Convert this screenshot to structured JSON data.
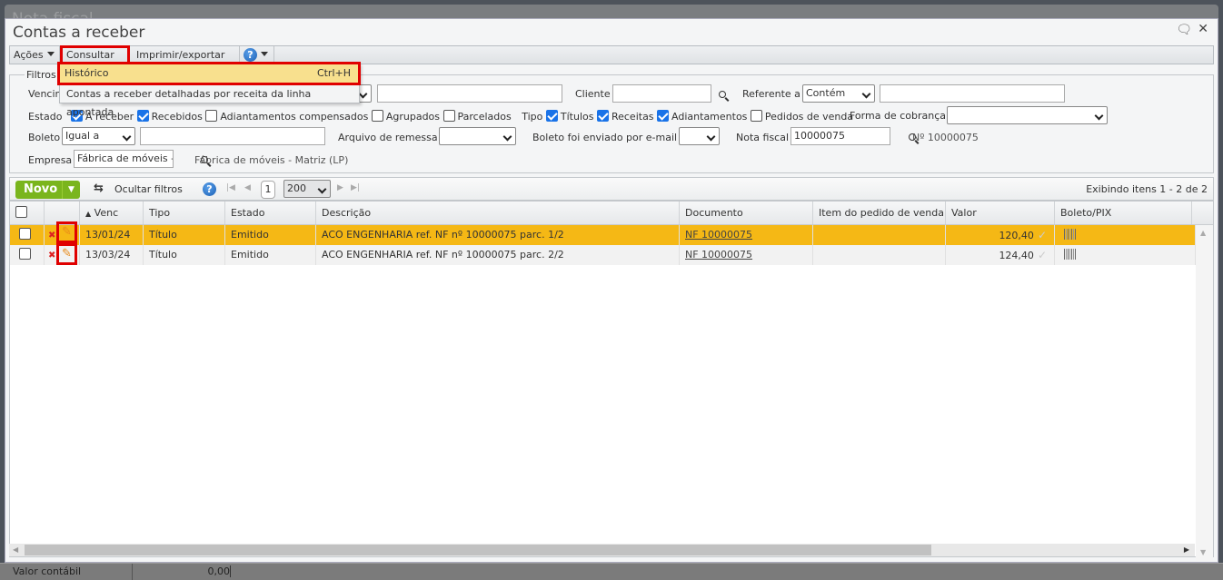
{
  "background_window": {
    "title": "Nota fiscal"
  },
  "window": {
    "title": "Contas a receber"
  },
  "toolbar": {
    "acoes": "Ações",
    "consultar": "Consultar",
    "imprimir": "Imprimir/exportar",
    "help": "?"
  },
  "menu": {
    "items": [
      {
        "label": "Histórico",
        "shortcut": "Ctrl+H"
      },
      {
        "label": "Contas a receber detalhadas por receita da linha apontada"
      }
    ]
  },
  "filters": {
    "legend": "Filtros",
    "vencimento_label": "Vencim",
    "cliente_label": "Cliente",
    "cliente_value": "",
    "referente_label": "Referente a",
    "referente_value": "Contém",
    "estado_label": "Estado",
    "estado_options": [
      {
        "label": "A receber",
        "checked": true
      },
      {
        "label": "Recebidos",
        "checked": true
      },
      {
        "label": "Adiantamentos compensados",
        "checked": false
      },
      {
        "label": "Agrupados",
        "checked": false
      },
      {
        "label": "Parcelados",
        "checked": false
      }
    ],
    "tipo_label": "Tipo",
    "tipo_options": [
      {
        "label": "Títulos",
        "checked": true
      },
      {
        "label": "Receitas",
        "checked": true
      },
      {
        "label": "Adiantamentos",
        "checked": true
      },
      {
        "label": "Pedidos de venda",
        "checked": false
      }
    ],
    "forma_label": "Forma de cobrança",
    "boleto_label": "Boleto",
    "boleto_op": "Igual a",
    "arquivo_label": "Arquivo de remessa",
    "email_label": "Boleto foi enviado por e-mail",
    "nf_label": "Nota fiscal",
    "nf_value": "10000075",
    "nf_desc": "Nº 10000075",
    "empresa_label": "Empresa",
    "empresa_value": "Fábrica de móveis - Matriz (LP)",
    "empresa_desc": "Fábrica de móveis - Matriz (LP)"
  },
  "grid_toolbar": {
    "novo": "Novo",
    "ocultar": "Ocultar filtros",
    "page": "1",
    "page_size": "200",
    "status": "Exibindo itens 1 - 2 de 2"
  },
  "columns": [
    "Venc",
    "Tipo",
    "Estado",
    "Descrição",
    "Documento",
    "Item do pedido de venda",
    "Valor",
    "Boleto/PIX"
  ],
  "rows": [
    {
      "venc": "13/01/24",
      "tipo": "Título",
      "estado": "Emitido",
      "descricao": "ACO ENGENHARIA ref. NF nº 10000075 parc. 1/2",
      "documento": "NF 10000075",
      "item": "",
      "valor": "120,40",
      "selected": true
    },
    {
      "venc": "13/03/24",
      "tipo": "Título",
      "estado": "Emitido",
      "descricao": "ACO ENGENHARIA ref. NF nº 10000075 parc. 2/2",
      "documento": "NF 10000075",
      "item": "",
      "valor": "124,40",
      "selected": false
    }
  ],
  "footer": {
    "label": "Valor contábil",
    "value": "0,00"
  }
}
